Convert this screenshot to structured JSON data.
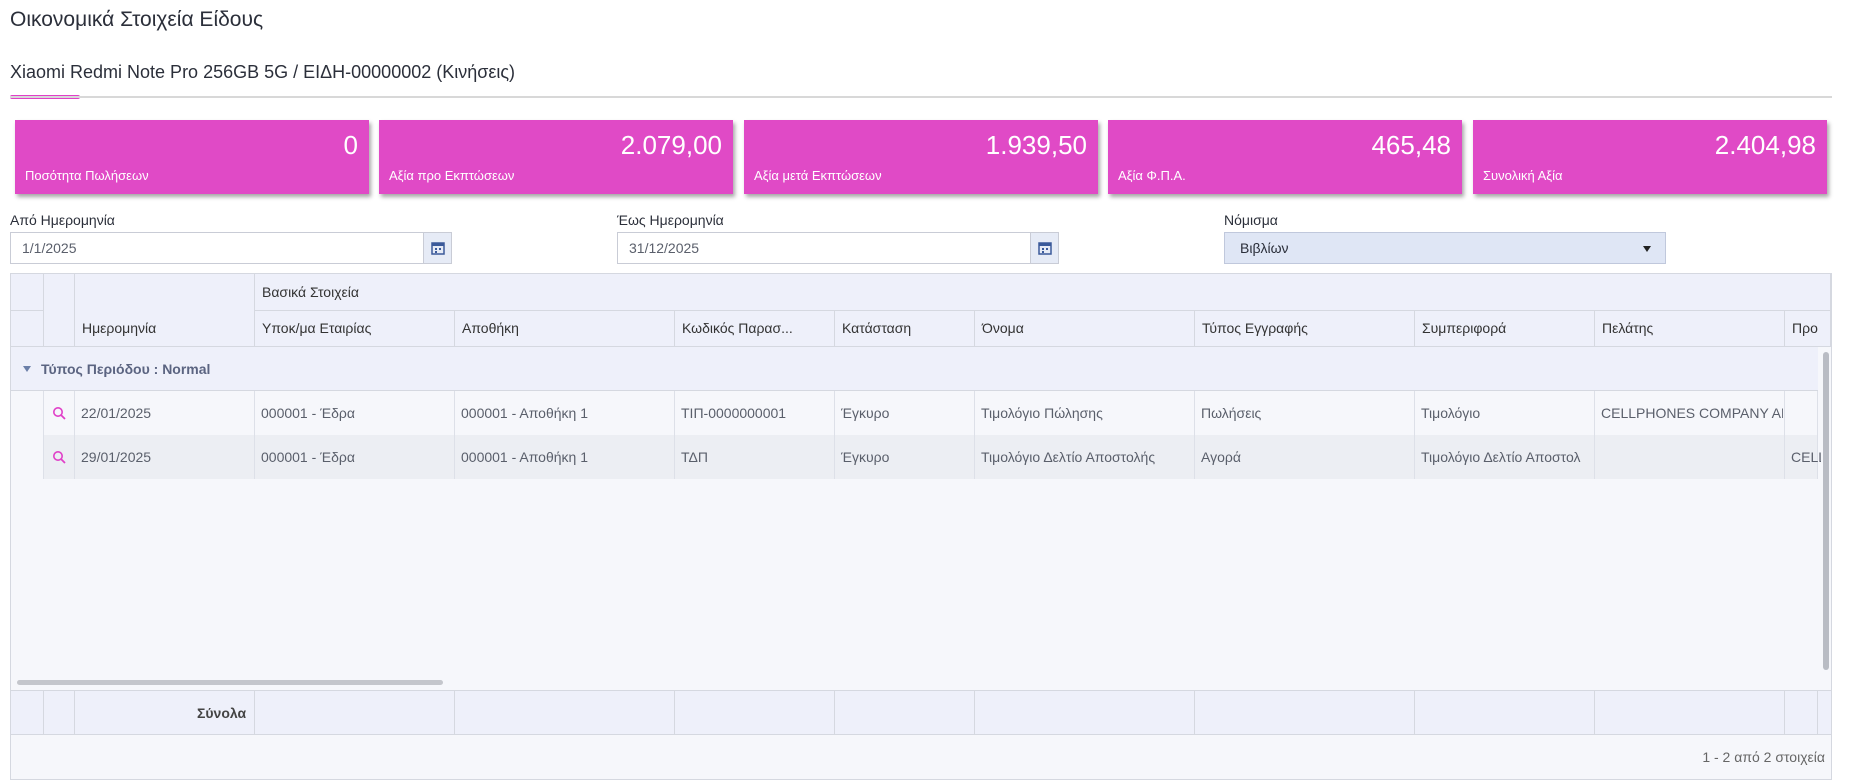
{
  "page": {
    "title": "Οικονομικά Στοιχεία Είδους",
    "tab_title": "Xiaomi Redmi Note Pro 256GB 5G / ΕΙΔΗ-00000002 (Κινήσεις)"
  },
  "colors": {
    "accent": "#e04ac6",
    "header_bg": "#eef0fa"
  },
  "cards": [
    {
      "value": "0",
      "label": "Ποσότητα Πωλήσεων"
    },
    {
      "value": "2.079,00",
      "label": "Αξία προ Εκπτώσεων"
    },
    {
      "value": "1.939,50",
      "label": "Αξία μετά Εκπτώσεων"
    },
    {
      "value": "465,48",
      "label": "Αξία Φ.Π.Α."
    },
    {
      "value": "2.404,98",
      "label": "Συνολική Αξία"
    }
  ],
  "filters": {
    "from_label": "Από Ημερομηνία",
    "from_value": "1/1/2025",
    "to_label": "Έως Ημερομηνία",
    "to_value": "31/12/2025",
    "currency_label": "Νόμισμα",
    "currency_value": "Βιβλίων"
  },
  "grid": {
    "group_header": "Βασικά Στοιχεία",
    "columns": [
      "Ημερομηνία",
      "Υποκ/μα Εταιρίας",
      "Αποθήκη",
      "Κωδικός Παρασ...",
      "Κατάσταση",
      "Όνομα",
      "Τύπος Εγγραφής",
      "Συμπεριφορά",
      "Πελάτης",
      "Προ"
    ],
    "group_row": "Τύπος Περιόδου : Normal",
    "rows": [
      [
        "22/01/2025",
        "000001 - Έδρα",
        "000001 - Αποθήκη 1",
        "ΤΙΠ-0000000001",
        "Έγκυρο",
        "Τιμολόγιο Πώλησης",
        "Πωλήσεις",
        "Τιμολόγιο",
        "CELLPHONES COMPANY AE",
        ""
      ],
      [
        "29/01/2025",
        "000001 - Έδρα",
        "000001 - Αποθήκη 1",
        "ΤΔΠ",
        "Έγκυρο",
        "Τιμολόγιο Δελτίο Αποστολής",
        "Αγορά",
        "Τιμολόγιο Δελτίο Αποστολ",
        "",
        "CELL"
      ]
    ],
    "totals_label": "Σύνολα",
    "pager": "1 - 2 από 2 στοιχεία"
  }
}
